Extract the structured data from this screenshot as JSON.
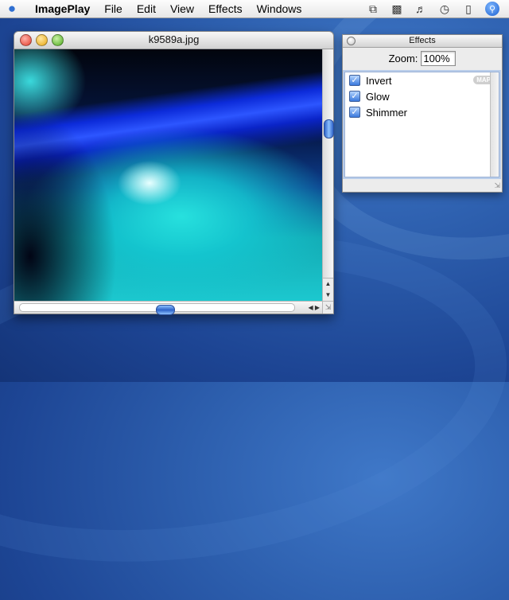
{
  "menubar": {
    "apple_icon": "apple-logo-icon",
    "app_name": "ImagePlay",
    "items": [
      "File",
      "Edit",
      "View",
      "Effects",
      "Windows"
    ],
    "status_icons": [
      "bluetooth-icon",
      "display-icon",
      "volume-icon",
      "clock-icon",
      "battery-icon",
      "spotlight-icon"
    ]
  },
  "image_window": {
    "title": "k9589a.jpg"
  },
  "effects_palette": {
    "title": "Effects",
    "zoom_label": "Zoom:",
    "zoom_value": "100%",
    "badge": "MAP",
    "effects": [
      {
        "label": "Invert",
        "checked": true
      },
      {
        "label": "Glow",
        "checked": true
      },
      {
        "label": "Shimmer",
        "checked": true
      }
    ]
  },
  "colors": {
    "desktop_blue": "#2d5fae",
    "selection_blue": "#3a79dd"
  }
}
